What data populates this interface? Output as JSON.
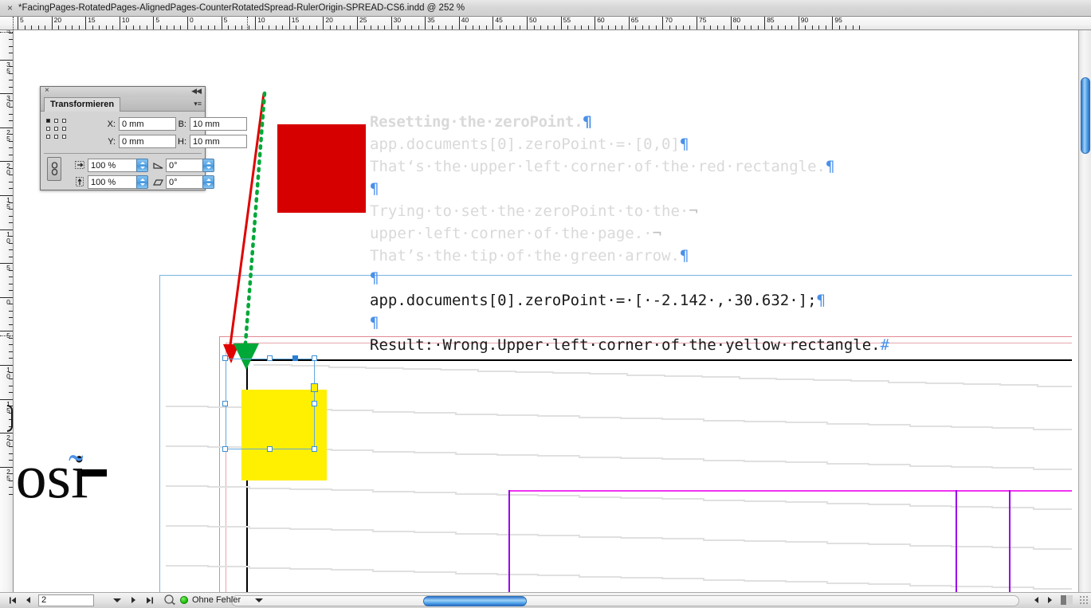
{
  "window": {
    "tab_close_label": "×",
    "document_title": "*FacingPages-RotatedPages-AlignedPages-CounterRotatedSpread-RulerOrigin-SPREAD-CS6.indd @ 252 %"
  },
  "rulers": {
    "units": "mm",
    "horizontal_labels": [
      "5",
      "20",
      "15",
      "10",
      "5",
      "0",
      "5",
      "10",
      "15",
      "20",
      "25",
      "30",
      "35",
      "40",
      "45",
      "50",
      "55",
      "60",
      "65",
      "70",
      "75",
      "80",
      "85",
      "90",
      "95"
    ],
    "vertical_labels": [
      "5",
      "35",
      "30",
      "25",
      "20",
      "15",
      "10",
      "5",
      "0",
      "5",
      "10",
      "15",
      "20",
      "25"
    ]
  },
  "transform_panel": {
    "title": "Transformieren",
    "close_label": "×",
    "collapse_label": "◀◀",
    "menu_label": "▾≡",
    "fields": {
      "x_label": "X:",
      "x_value": "0 mm",
      "y_label": "Y:",
      "y_value": "0 mm",
      "w_label": "B:",
      "w_value": "10 mm",
      "h_label": "H:",
      "h_value": "10 mm",
      "scale_x_value": "100 %",
      "scale_y_value": "100 %",
      "rotate_value": "0°",
      "shear_value": "0°"
    }
  },
  "script_text": {
    "lines": [
      {
        "text": "Resetting·the·zeroPoint.",
        "mark": "¶",
        "style": "light-bold"
      },
      {
        "text": "app.documents[0].zeroPoint·=·[0,0]",
        "mark": "¶",
        "style": "light"
      },
      {
        "text": "That‘s·the·upper·left·corner·of·the·red·rectangle.",
        "mark": "¶",
        "style": "light"
      },
      {
        "text": "",
        "mark": "¶",
        "style": "light"
      },
      {
        "text": "Trying·to·set·the·zeroPoint·to·the·",
        "mark": "¬",
        "style": "light"
      },
      {
        "text": "upper·left·corner·of·the·page.·",
        "mark": "¬",
        "style": "light"
      },
      {
        "text": "That’s·the·tip·of·the·green·arrow.",
        "mark": "¶",
        "style": "light"
      },
      {
        "text": "",
        "mark": "¶",
        "style": "dark"
      },
      {
        "text": "app.documents[0].zeroPoint·=·[·-2.142·,·30.632·];",
        "mark": "¶",
        "style": "dark"
      },
      {
        "text": "",
        "mark": "¶",
        "style": "dark"
      },
      {
        "text": "Result:·Wrong.Upper·left·corner·of·the·yellow·rectangle.",
        "mark": "#",
        "style": "dark"
      }
    ]
  },
  "page_content": {
    "big_text": " osi",
    "tilde": "˜"
  },
  "status_bar": {
    "first_page_label": "⏮",
    "prev_page_label": "◀",
    "page_value": "2",
    "next_page_label": "▶",
    "last_page_label": "⏭",
    "preflight_icon": "preflight-icon",
    "error_status": "Ohne Fehler",
    "dropdown_label": "▾"
  },
  "colors": {
    "red_rectangle": "#d70000",
    "yellow_rectangle": "#ffef00",
    "red_arrow": "#e00000",
    "green_arrow": "#00a838",
    "selection_blue": "#61a9e0",
    "magenta_guide": "#ef34ef",
    "purple_guide": "#9900ee",
    "light_blue_guide": "#7ab4dd",
    "pink_page_frame": "#e08a94",
    "script_light_text": "#d9d9d9",
    "script_dark_text": "#1a1a1a",
    "pilcrow_blue": "#4a90e8"
  }
}
